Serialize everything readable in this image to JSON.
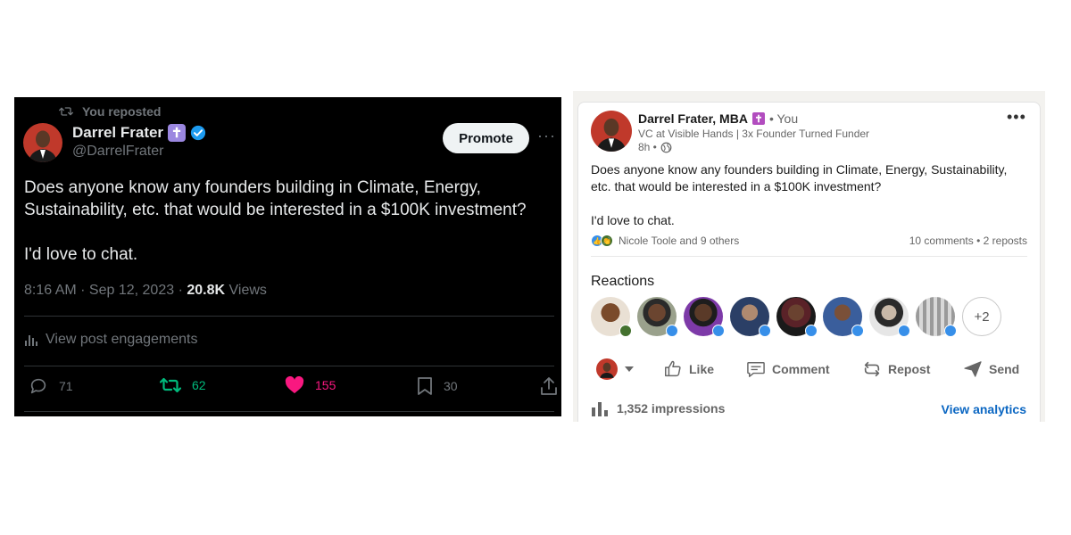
{
  "twitter": {
    "repost_label": "You reposted",
    "author_name": "Darrel Frater",
    "author_badge": "✝",
    "author_handle": "@DarrelFrater",
    "promote_label": "Promote",
    "post_text_line1": "Does anyone know any founders building in Climate, Energy, Sustainability, etc. that would be interested in a $100K investment?",
    "post_text_line2": "I'd love to chat.",
    "timestamp": "8:16 AM · Sep 12, 2023 · ",
    "views_count": "20.8K",
    "views_label": "Views",
    "engagements_label": "View post engagements",
    "reply_count": "71",
    "repost_count": "62",
    "like_count": "155",
    "bookmark_count": "30",
    "colors": {
      "background": "#000000",
      "verified": "#1d9bf0",
      "repost": "#00ba7c",
      "like": "#f91880"
    },
    "icons": [
      "repost-icon",
      "verified-icon",
      "more-icon",
      "analytics-icon",
      "reply-icon",
      "like-icon",
      "bookmark-icon",
      "share-icon"
    ]
  },
  "linkedin": {
    "author_name": "Darrel Frater, MBA",
    "author_badge": "✝",
    "connection": "• You",
    "headline": "VC at Visible Hands | 3x Founder Turned Funder",
    "time_ago": "8h •",
    "post_text_line1": "Does anyone know any founders building in Climate, Energy, Sustainability, etc. that would be interested in a $100K investment?",
    "post_text_line2": "I'd love to chat.",
    "reactors_summary": "Nicole Toole and 9 others",
    "comments_count": "10 comments",
    "reposts_count": "2 reposts",
    "reactions_title": "Reactions",
    "more_reactors": "+2",
    "actions": {
      "like": "Like",
      "comment": "Comment",
      "repost": "Repost",
      "send": "Send"
    },
    "impressions": "1,352 impressions",
    "analytics_label": "View analytics",
    "colors": {
      "link": "#0a66c2",
      "like_badge": "#378fe9",
      "celebrate_badge": "#44712e"
    },
    "icons": [
      "globe-icon",
      "like-icon",
      "celebrate-icon",
      "comment-icon",
      "repost-icon",
      "send-icon",
      "bar-chart-icon",
      "caret-down-icon"
    ]
  }
}
